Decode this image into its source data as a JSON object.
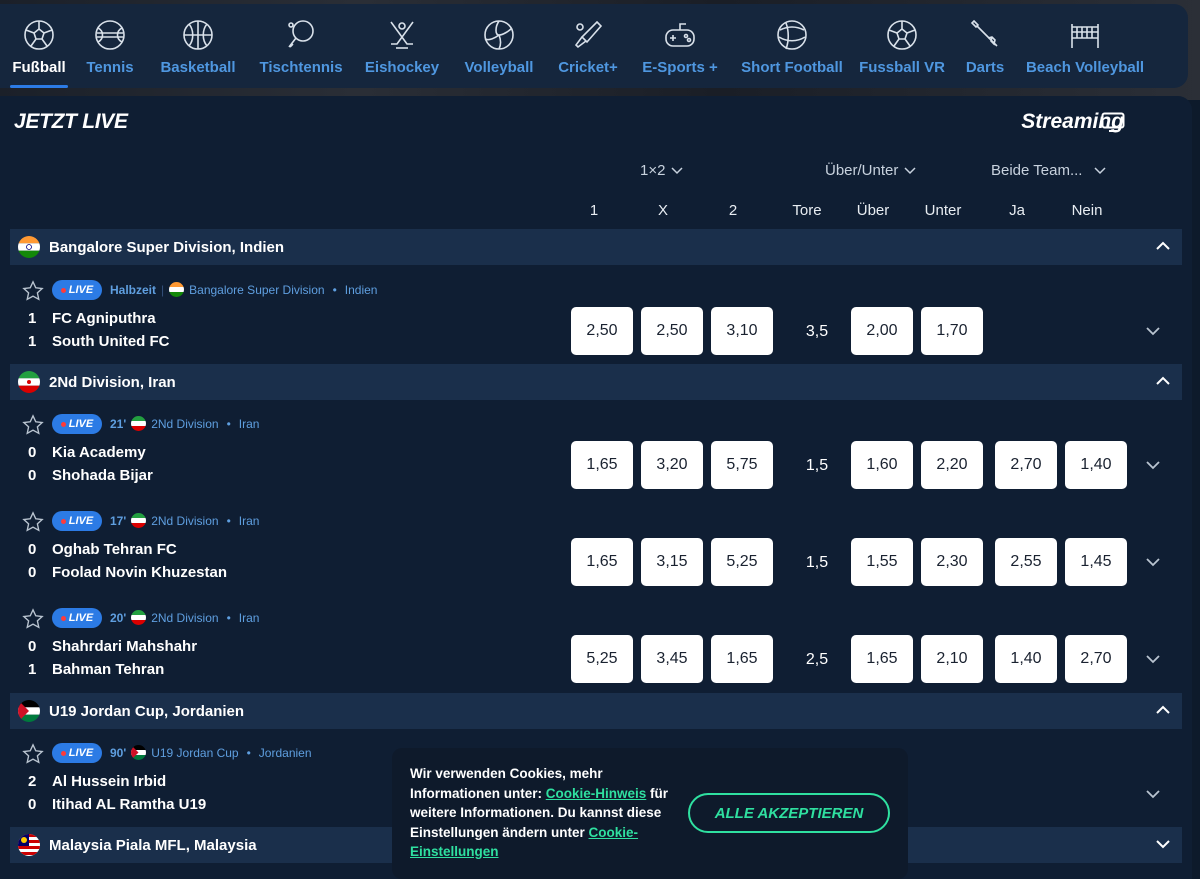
{
  "sports": [
    {
      "label": "Fußball",
      "icon": "soccer-ball-icon",
      "active": true
    },
    {
      "label": "Tennis",
      "icon": "tennis-ball-icon"
    },
    {
      "label": "Basketball",
      "icon": "basketball-icon"
    },
    {
      "label": "Tischtennis",
      "icon": "table-tennis-icon"
    },
    {
      "label": "Eishockey",
      "icon": "hockey-sticks-icon"
    },
    {
      "label": "Volleyball",
      "icon": "volleyball-icon"
    },
    {
      "label": "Cricket+",
      "icon": "cricket-bat-icon"
    },
    {
      "label": "E-Sports +",
      "icon": "gamepad-icon"
    },
    {
      "label": "Short Football",
      "icon": "short-football-icon"
    },
    {
      "label": "Fussball VR",
      "icon": "soccer-vr-icon"
    },
    {
      "label": "Darts",
      "icon": "dart-icon"
    },
    {
      "label": "Beach Volleyball",
      "icon": "beach-volleyball-net-icon"
    }
  ],
  "header": {
    "title": "JETZT LIVE",
    "streaming": "Streaming"
  },
  "markets": {
    "m1": "1×2",
    "m2": "Über/Unter",
    "m3": "Beide Team..."
  },
  "columns": {
    "c1": "1",
    "cx": "X",
    "c2": "2",
    "tore": "Tore",
    "ueber": "Über",
    "unter": "Unter",
    "ja": "Ja",
    "nein": "Nein"
  },
  "leagues": [
    {
      "name": "Bangalore Super Division, Indien"
    },
    {
      "name": "2Nd Division, Iran"
    },
    {
      "name": "U19 Jordan Cup, Jordanien"
    },
    {
      "name": "Malaysia Piala MFL, Malaysia"
    }
  ],
  "live_label": "LIVE",
  "matches": [
    {
      "time": "Halbzeit",
      "competition": "Bangalore Super Division",
      "country": "Indien",
      "home": "FC Agniputhra",
      "away": "South United FC",
      "home_score": "1",
      "away_score": "1",
      "o1": "2,50",
      "ox": "2,50",
      "o2": "3,10",
      "tore": "3,5",
      "ueber": "2,00",
      "unter": "1,70",
      "ja": "",
      "nein": ""
    },
    {
      "time": "21'",
      "competition": "2Nd Division",
      "country": "Iran",
      "home": "Kia Academy",
      "away": "Shohada Bijar",
      "home_score": "0",
      "away_score": "0",
      "o1": "1,65",
      "ox": "3,20",
      "o2": "5,75",
      "tore": "1,5",
      "ueber": "1,60",
      "unter": "2,20",
      "ja": "2,70",
      "nein": "1,40"
    },
    {
      "time": "17'",
      "competition": "2Nd Division",
      "country": "Iran",
      "home": "Oghab Tehran FC",
      "away": "Foolad Novin Khuzestan",
      "home_score": "0",
      "away_score": "0",
      "o1": "1,65",
      "ox": "3,15",
      "o2": "5,25",
      "tore": "1,5",
      "ueber": "1,55",
      "unter": "2,30",
      "ja": "2,55",
      "nein": "1,45"
    },
    {
      "time": "20'",
      "competition": "2Nd Division",
      "country": "Iran",
      "home": "Shahrdari Mahshahr",
      "away": "Bahman Tehran",
      "home_score": "0",
      "away_score": "1",
      "o1": "5,25",
      "ox": "3,45",
      "o2": "1,65",
      "tore": "2,5",
      "ueber": "1,65",
      "unter": "2,10",
      "ja": "1,40",
      "nein": "2,70"
    },
    {
      "time": "90'",
      "competition": "U19 Jordan Cup",
      "country": "Jordanien",
      "home": "Al Hussein Irbid",
      "away": "Itihad AL Ramtha U19",
      "home_score": "2",
      "away_score": "0"
    }
  ],
  "cookie": {
    "text1": "Wir verwenden Cookies, mehr Informationen unter: ",
    "link1": "Cookie-Hinweis",
    "text2": " für weitere Informationen. Du kannst diese Einstellungen ändern unter ",
    "link2": "Cookie-Einstellungen",
    "accept": "ALLE AKZEPTIEREN"
  },
  "colors": {
    "accent": "#2c7be5",
    "panel": "#0f1e33",
    "league_bar": "#1a2f4b",
    "cookie_accent": "#2fe0a0",
    "link": "#4f97e0"
  }
}
